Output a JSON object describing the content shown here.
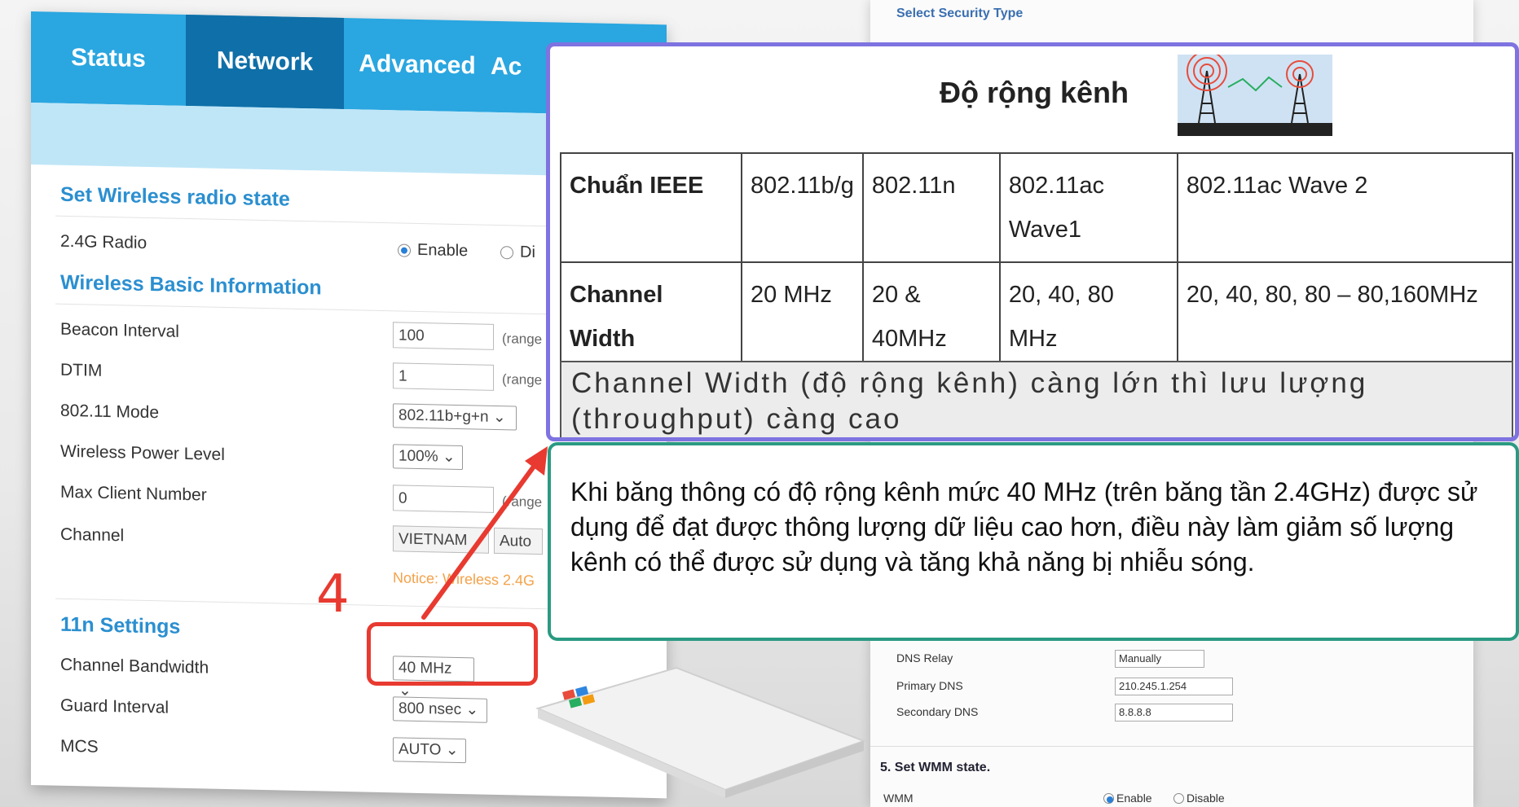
{
  "router": {
    "tabs": [
      "Status",
      "Network",
      "Advanced",
      "Ac"
    ],
    "sections": {
      "radio_state": "Set Wireless radio state",
      "basic_info": "Wireless Basic Information",
      "n_settings": "11n Settings"
    },
    "radio": {
      "label": "2.4G Radio",
      "enable": "Enable",
      "disable": "Di"
    },
    "fields": {
      "beacon": {
        "label": "Beacon Interval",
        "value": "100",
        "hint": "(range"
      },
      "dtim": {
        "label": "DTIM",
        "value": "1",
        "hint": "(range"
      },
      "mode": {
        "label": "802.11 Mode",
        "value": "802.11b+g+n"
      },
      "power": {
        "label": "Wireless Power Level",
        "value": "100%"
      },
      "max_client": {
        "label": "Max Client Number",
        "value": "0",
        "hint": "(range"
      },
      "channel": {
        "label": "Channel",
        "country": "VIETNAM",
        "value": "Auto"
      },
      "notice": "Notice: Wireless 2.4G",
      "bandwidth": {
        "label": "Channel Bandwidth",
        "value": "40 MHz"
      },
      "guard": {
        "label": "Guard Interval",
        "value": "800 nsec"
      },
      "mcs": {
        "label": "MCS",
        "value": "AUTO"
      }
    },
    "step_number": "4"
  },
  "right_panel": {
    "security_title": "Select Security Type",
    "dns_relay": {
      "label": "DNS Relay",
      "value": "Manually"
    },
    "primary_dns": {
      "label": "Primary DNS",
      "value": "210.245.1.254"
    },
    "secondary_dns": {
      "label": "Secondary DNS",
      "value": "8.8.8.8"
    },
    "wmm_title": "5. Set WMM state.",
    "wmm": {
      "label": "WMM",
      "enable": "Enable",
      "disable": "Disable"
    }
  },
  "table_card": {
    "title": "Độ rộng kênh",
    "rows": [
      [
        "Chuẩn IEEE",
        "802.11b/g",
        "802.11n",
        "802.11ac Wave1",
        "802.11ac Wave 2"
      ],
      [
        "Channel Width",
        "20 MHz",
        "20 & 40MHz",
        "20, 40, 80 MHz",
        "20, 40, 80, 80 – 80,160MHz"
      ]
    ],
    "note": "Channel Width (độ rộng kênh) càng lớn thì lưu lượng (throughput) càng cao"
  },
  "info_card": {
    "text": "Khi băng thông có độ rộng kênh mức 40 MHz (trên băng tần 2.4GHz) được sử dụng để đạt được thông lượng dữ liệu cao hơn, điều này làm giảm số lượng kênh có thể được sử dụng và tăng khả năng bị nhiễu sóng."
  },
  "colors": {
    "nav_blue": "#2aa6e0",
    "nav_active": "#0f6fa8",
    "highlight_red": "#e83a30",
    "card_border_purple": "#7e73e0",
    "card_border_teal": "#2a9a82"
  }
}
